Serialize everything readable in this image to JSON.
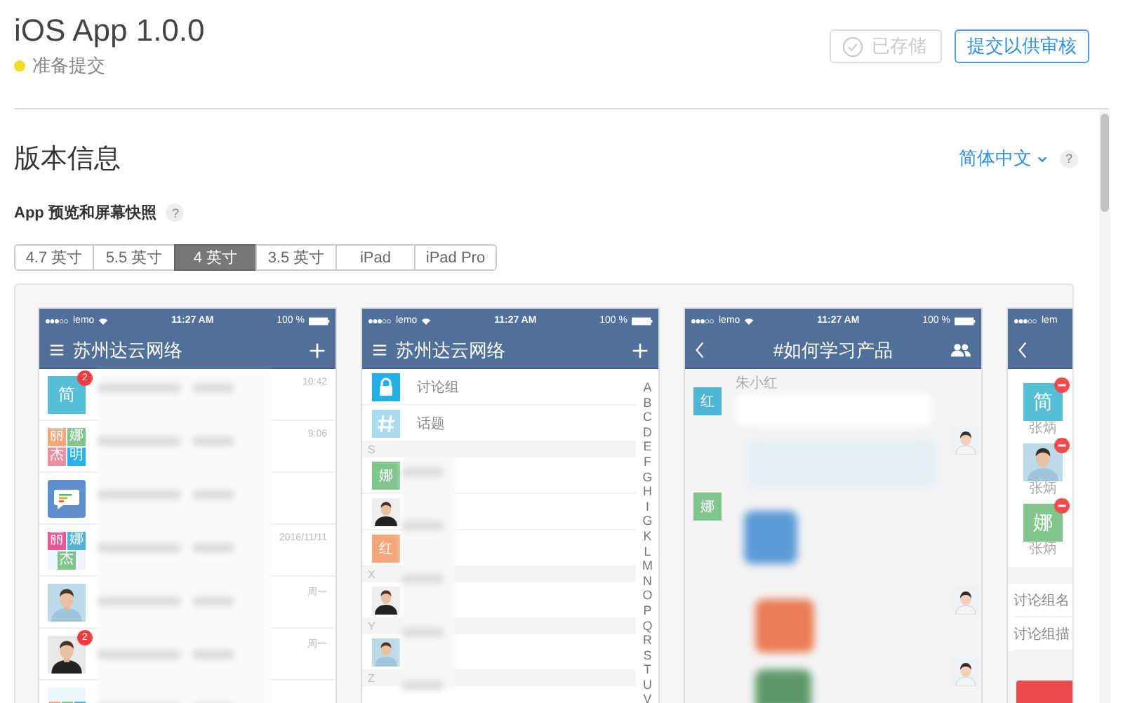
{
  "header": {
    "title": "iOS App 1.0.0",
    "status": {
      "label": "准备提交",
      "color": "#f2dc2b"
    },
    "buttons": [
      {
        "label": "已存储",
        "disabled": true
      },
      {
        "label": "提交以供审核",
        "disabled": false
      }
    ]
  },
  "version_info": {
    "title": "版本信息",
    "language": "简体中文",
    "help": "?",
    "media_title": "App 预览和屏幕快照",
    "media_help": "?"
  },
  "size_tabs": [
    {
      "label": "4.7 英寸",
      "selected": false
    },
    {
      "label": "5.5 英寸",
      "selected": false
    },
    {
      "label": "4 英寸",
      "selected": true
    },
    {
      "label": "3.5 英寸",
      "selected": false
    },
    {
      "label": "iPad",
      "selected": false
    },
    {
      "label": "iPad Pro",
      "selected": false
    }
  ],
  "screenshots": [
    {
      "kind": "messages",
      "status_bar": {
        "carrier": "lemo",
        "time": "11:27 AM",
        "battery": "100 %"
      },
      "nav": {
        "title": "苏州达云网络"
      },
      "rows": [
        {
          "avatar": {
            "kind": "letter",
            "label": "简",
            "color": "#56bfd8"
          },
          "badge": "2",
          "time": "10:42"
        },
        {
          "avatar": {
            "kind": "grid",
            "cells": [
              {
                "label": "丽",
                "color": "#f4a77a"
              },
              {
                "label": "娜",
                "color": "#7fc58c"
              },
              {
                "label": "杰",
                "color": "#f08fa0"
              },
              {
                "label": "明",
                "color": "#27b2ee"
              }
            ]
          },
          "time": "9:06"
        },
        {
          "avatar": {
            "kind": "icon",
            "color": "#5d8fcf"
          }
        },
        {
          "avatar": {
            "kind": "grid",
            "cells": [
              {
                "label": "丽",
                "color": "#e8579a"
              },
              {
                "label": "娜",
                "color": "#4fb3d6"
              },
              {
                "label": "杰",
                "color": "#7fc58c"
              }
            ]
          },
          "time": "2016/11/11"
        },
        {
          "time": "周一"
        },
        {
          "badge": "2",
          "time": "周一"
        },
        {
          "avatar": {
            "kind": "grid-top",
            "cells": [
              {
                "color": "#f4a77a"
              },
              {
                "color": "#7fc58c"
              },
              {
                "color": "#4fb3d6"
              }
            ]
          }
        }
      ]
    },
    {
      "kind": "contacts",
      "status_bar": {
        "carrier": "lemo",
        "time": "11:27 AM",
        "battery": "100 %"
      },
      "nav": {
        "title": "苏州达云网络"
      },
      "rows": [
        {
          "kind": "locked-group",
          "label": "讨论组",
          "color": "#22b0e6"
        },
        {
          "kind": "topic-group",
          "label": "话题",
          "color": "#a9dcef"
        },
        {
          "kind": "header",
          "label": "S"
        },
        {
          "kind": "contact",
          "avatar": {
            "kind": "letter",
            "label": "娜",
            "color": "#7fc58c"
          }
        },
        {
          "kind": "contact"
        },
        {
          "kind": "contact",
          "avatar": {
            "kind": "letter",
            "label": "红",
            "color": "#f4a77a"
          }
        },
        {
          "kind": "header",
          "label": "X"
        },
        {
          "kind": "contact"
        },
        {
          "kind": "header",
          "label": "Y"
        },
        {
          "kind": "contact"
        },
        {
          "kind": "header",
          "label": "Z"
        }
      ],
      "index": [
        "A",
        "B",
        "C",
        "D",
        "E",
        "F",
        "G",
        "H",
        "I",
        "G",
        "K",
        "L",
        "M",
        "N",
        "O",
        "P",
        "Q",
        "R",
        "S",
        "T",
        "U",
        "V"
      ]
    },
    {
      "kind": "chat",
      "status_bar": {
        "carrier": "lemo",
        "time": "11:27 AM",
        "battery": "100 %"
      },
      "nav": {
        "title": "#如何学习产品"
      },
      "sender": "朱小红",
      "left_avatars": [
        {
          "label": "红",
          "color": "#4cb6d4"
        },
        {
          "label": "娜",
          "color": "#7fc58c"
        }
      ]
    },
    {
      "kind": "members",
      "status_bar": {
        "carrier": "lem"
      },
      "members": [
        {
          "avatar": {
            "kind": "letter",
            "label": "简",
            "color": "#56bfd8"
          },
          "name": "张炳"
        },
        {
          "name": "张炳"
        },
        {
          "avatar": {
            "kind": "letter",
            "label": "娜",
            "color": "#7fc58c"
          },
          "name": "张炳"
        }
      ],
      "fields": [
        "讨论组名",
        "讨论组描"
      ],
      "button": {
        "color": "#ee4c4c"
      }
    }
  ]
}
